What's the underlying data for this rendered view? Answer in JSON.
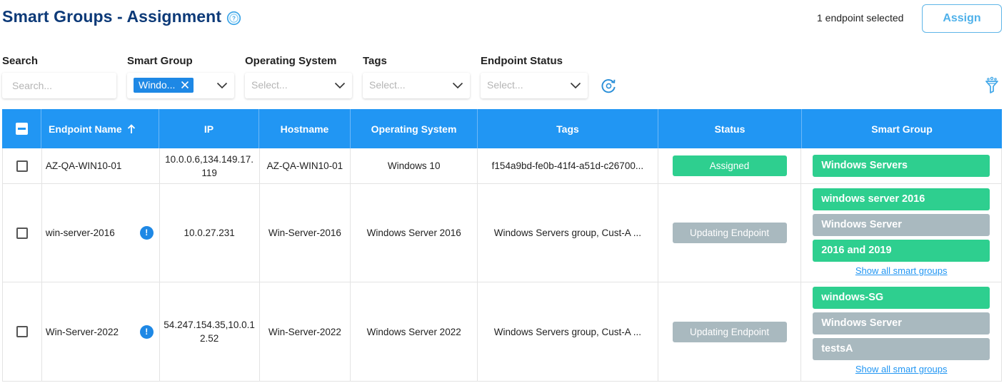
{
  "header": {
    "title": "Smart Groups - Assignment",
    "selected_text": "1 endpoint selected",
    "assign_label": "Assign"
  },
  "filters": {
    "search": {
      "label": "Search",
      "placeholder": "Search..."
    },
    "smart_group": {
      "label": "Smart Group",
      "chip": "Windo..."
    },
    "operating_system": {
      "label": "Operating System",
      "placeholder": "Select..."
    },
    "tags": {
      "label": "Tags",
      "placeholder": "Select..."
    },
    "endpoint_status": {
      "label": "Endpoint Status",
      "placeholder": "Select..."
    }
  },
  "table": {
    "columns": [
      "Endpoint Name",
      "IP",
      "Hostname",
      "Operating System",
      "Tags",
      "Status",
      "Smart Group"
    ],
    "rows": [
      {
        "endpoint_name": "AZ-QA-WIN10-01",
        "ip": "10.0.0.6,134.149.17.119",
        "hostname": "AZ-QA-WIN10-01",
        "os": "Windows 10",
        "tags": "f154a9bd-fe0b-41f4-a51d-c26700...",
        "status": "Assigned",
        "smart_groups": [
          "Windows Servers"
        ],
        "show_all": ""
      },
      {
        "endpoint_name": "win-server-2016",
        "ip": "10.0.27.231",
        "hostname": "Win-Server-2016",
        "os": "Windows Server 2016",
        "tags": "Windows Servers group, Cust-A ...",
        "status": "Updating Endpoint",
        "smart_groups": [
          "windows server 2016",
          "Windows Server",
          "2016 and 2019"
        ],
        "show_all": "Show all smart groups"
      },
      {
        "endpoint_name": "Win-Server-2022",
        "ip": "54.247.154.35,10.0.12.52",
        "hostname": "Win-Server-2022",
        "os": "Windows Server 2022",
        "tags": "Windows Servers group, Cust-A ...",
        "status": "Updating Endpoint",
        "smart_groups": [
          "windows-SG",
          "Windows Server",
          "testsA"
        ],
        "show_all": "Show all smart groups"
      }
    ]
  },
  "icons": {
    "help": "help-circle-icon",
    "clear_chip": "close-icon",
    "dropdown": "chevron-down-icon",
    "reset": "refresh-icon",
    "filter": "filter-icon",
    "sort": "arrow-up-icon",
    "warning": "info-icon"
  },
  "colors": {
    "title": "#0d3a78",
    "header_bg": "#2196f3",
    "assigned": "#2ecf8f",
    "updating": "#a9b9bf",
    "link": "#2196f3"
  }
}
